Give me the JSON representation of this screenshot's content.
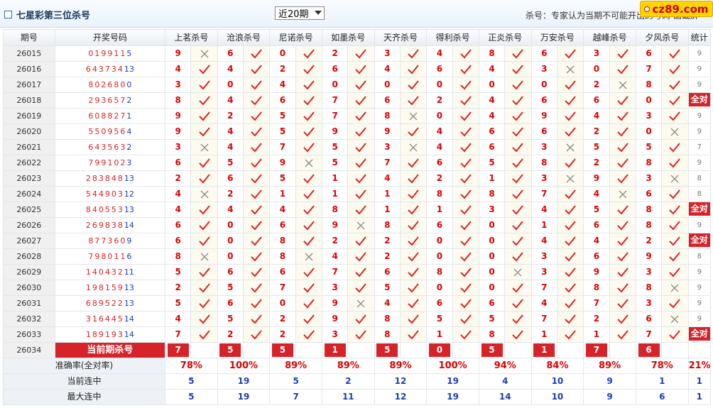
{
  "header": {
    "title": "七星彩第三位杀号",
    "select_value": "近20期",
    "note": "杀号：专家认为当期不可能开出的号码 画截屏",
    "logo": "cz89.com"
  },
  "columns": {
    "period": "期号",
    "draw": "开奖号码",
    "experts": [
      "上茗杀号",
      "沧浪杀号",
      "尼诺杀号",
      "如墨杀号",
      "天齐杀号",
      "得利杀号",
      "正炎杀号",
      "万安杀号",
      "越峰杀号",
      "夕风杀号"
    ],
    "stat": "统计"
  },
  "rows": [
    {
      "period": "26015",
      "draw_digits": "019911",
      "draw_last": "5",
      "cells": [
        [
          "9",
          "x"
        ],
        [
          "6",
          "v"
        ],
        [
          "0",
          "v"
        ],
        [
          "2",
          "v"
        ],
        [
          "3",
          "v"
        ],
        [
          "4",
          "v"
        ],
        [
          "8",
          "v"
        ],
        [
          "6",
          "v"
        ],
        [
          "3",
          "v"
        ],
        [
          "6",
          "v"
        ]
      ],
      "stat": "9"
    },
    {
      "period": "26016",
      "draw_digits": "643734",
      "draw_last": "13",
      "cells": [
        [
          "4",
          "v"
        ],
        [
          "4",
          "v"
        ],
        [
          "2",
          "v"
        ],
        [
          "6",
          "v"
        ],
        [
          "4",
          "v"
        ],
        [
          "6",
          "v"
        ],
        [
          "4",
          "v"
        ],
        [
          "3",
          "x"
        ],
        [
          "0",
          "v"
        ],
        [
          "7",
          "v"
        ]
      ],
      "stat": "9"
    },
    {
      "period": "26017",
      "draw_digits": "802680",
      "draw_last": "0",
      "cells": [
        [
          "3",
          "v"
        ],
        [
          "0",
          "v"
        ],
        [
          "4",
          "v"
        ],
        [
          "0",
          "v"
        ],
        [
          "0",
          "v"
        ],
        [
          "0",
          "v"
        ],
        [
          "0",
          "v"
        ],
        [
          "0",
          "v"
        ],
        [
          "2",
          "x"
        ],
        [
          "8",
          "v"
        ]
      ],
      "stat": "9"
    },
    {
      "period": "26018",
      "draw_digits": "293657",
      "draw_last": "2",
      "cells": [
        [
          "8",
          "v"
        ],
        [
          "4",
          "v"
        ],
        [
          "6",
          "v"
        ],
        [
          "7",
          "v"
        ],
        [
          "6",
          "v"
        ],
        [
          "2",
          "v"
        ],
        [
          "4",
          "v"
        ],
        [
          "6",
          "v"
        ],
        [
          "6",
          "v"
        ],
        [
          "0",
          "v"
        ]
      ],
      "stat": "全对"
    },
    {
      "period": "26019",
      "draw_digits": "608827",
      "draw_last": "1",
      "cells": [
        [
          "9",
          "v"
        ],
        [
          "2",
          "v"
        ],
        [
          "5",
          "v"
        ],
        [
          "7",
          "v"
        ],
        [
          "8",
          "x"
        ],
        [
          "0",
          "v"
        ],
        [
          "4",
          "v"
        ],
        [
          "9",
          "v"
        ],
        [
          "4",
          "v"
        ],
        [
          "3",
          "v"
        ]
      ],
      "stat": "9"
    },
    {
      "period": "26020",
      "draw_digits": "550956",
      "draw_last": "4",
      "cells": [
        [
          "9",
          "v"
        ],
        [
          "4",
          "v"
        ],
        [
          "5",
          "v"
        ],
        [
          "9",
          "v"
        ],
        [
          "9",
          "v"
        ],
        [
          "4",
          "v"
        ],
        [
          "6",
          "v"
        ],
        [
          "6",
          "v"
        ],
        [
          "2",
          "v"
        ],
        [
          "0",
          "x"
        ]
      ],
      "stat": "9"
    },
    {
      "period": "26021",
      "draw_digits": "643563",
      "draw_last": "2",
      "cells": [
        [
          "3",
          "x"
        ],
        [
          "4",
          "v"
        ],
        [
          "7",
          "v"
        ],
        [
          "5",
          "v"
        ],
        [
          "3",
          "x"
        ],
        [
          "4",
          "v"
        ],
        [
          "6",
          "v"
        ],
        [
          "3",
          "x"
        ],
        [
          "5",
          "v"
        ],
        [
          "5",
          "v"
        ]
      ],
      "stat": "7"
    },
    {
      "period": "26022",
      "draw_digits": "799102",
      "draw_last": "3",
      "cells": [
        [
          "6",
          "v"
        ],
        [
          "5",
          "v"
        ],
        [
          "9",
          "x"
        ],
        [
          "5",
          "v"
        ],
        [
          "7",
          "v"
        ],
        [
          "6",
          "v"
        ],
        [
          "5",
          "v"
        ],
        [
          "8",
          "v"
        ],
        [
          "2",
          "v"
        ],
        [
          "8",
          "v"
        ]
      ],
      "stat": "9"
    },
    {
      "period": "26023",
      "draw_digits": "283848",
      "draw_last": "13",
      "cells": [
        [
          "2",
          "v"
        ],
        [
          "6",
          "v"
        ],
        [
          "5",
          "v"
        ],
        [
          "1",
          "v"
        ],
        [
          "4",
          "v"
        ],
        [
          "2",
          "v"
        ],
        [
          "1",
          "v"
        ],
        [
          "3",
          "x"
        ],
        [
          "9",
          "v"
        ],
        [
          "3",
          "x"
        ]
      ],
      "stat": "8"
    },
    {
      "period": "26024",
      "draw_digits": "544903",
      "draw_last": "12",
      "cells": [
        [
          "4",
          "x"
        ],
        [
          "2",
          "v"
        ],
        [
          "1",
          "v"
        ],
        [
          "1",
          "v"
        ],
        [
          "1",
          "v"
        ],
        [
          "8",
          "v"
        ],
        [
          "8",
          "v"
        ],
        [
          "7",
          "v"
        ],
        [
          "4",
          "x"
        ],
        [
          "6",
          "v"
        ]
      ],
      "stat": "8"
    },
    {
      "period": "26025",
      "draw_digits": "840553",
      "draw_last": "13",
      "cells": [
        [
          "4",
          "v"
        ],
        [
          "4",
          "v"
        ],
        [
          "4",
          "v"
        ],
        [
          "8",
          "v"
        ],
        [
          "1",
          "v"
        ],
        [
          "1",
          "v"
        ],
        [
          "3",
          "v"
        ],
        [
          "4",
          "v"
        ],
        [
          "5",
          "v"
        ],
        [
          "8",
          "v"
        ]
      ],
      "stat": "全对"
    },
    {
      "period": "26026",
      "draw_digits": "269838",
      "draw_last": "14",
      "cells": [
        [
          "6",
          "v"
        ],
        [
          "0",
          "v"
        ],
        [
          "6",
          "v"
        ],
        [
          "9",
          "x"
        ],
        [
          "8",
          "v"
        ],
        [
          "6",
          "v"
        ],
        [
          "0",
          "v"
        ],
        [
          "1",
          "v"
        ],
        [
          "6",
          "v"
        ],
        [
          "8",
          "v"
        ]
      ],
      "stat": "9"
    },
    {
      "period": "26027",
      "draw_digits": "877360",
      "draw_last": "9",
      "cells": [
        [
          "6",
          "v"
        ],
        [
          "0",
          "v"
        ],
        [
          "8",
          "v"
        ],
        [
          "2",
          "v"
        ],
        [
          "2",
          "v"
        ],
        [
          "0",
          "v"
        ],
        [
          "0",
          "v"
        ],
        [
          "4",
          "v"
        ],
        [
          "4",
          "v"
        ],
        [
          "2",
          "v"
        ]
      ],
      "stat": "全对"
    },
    {
      "period": "26028",
      "draw_digits": "798011",
      "draw_last": "6",
      "cells": [
        [
          "8",
          "x"
        ],
        [
          "0",
          "v"
        ],
        [
          "8",
          "x"
        ],
        [
          "4",
          "v"
        ],
        [
          "2",
          "v"
        ],
        [
          "0",
          "v"
        ],
        [
          "0",
          "v"
        ],
        [
          "3",
          "v"
        ],
        [
          "6",
          "v"
        ],
        [
          "9",
          "v"
        ]
      ],
      "stat": "8"
    },
    {
      "period": "26029",
      "draw_digits": "140432",
      "draw_last": "11",
      "cells": [
        [
          "5",
          "v"
        ],
        [
          "6",
          "v"
        ],
        [
          "6",
          "v"
        ],
        [
          "7",
          "v"
        ],
        [
          "6",
          "v"
        ],
        [
          "8",
          "v"
        ],
        [
          "0",
          "x"
        ],
        [
          "3",
          "v"
        ],
        [
          "9",
          "v"
        ],
        [
          "3",
          "v"
        ]
      ],
      "stat": "9"
    },
    {
      "period": "26030",
      "draw_digits": "198159",
      "draw_last": "13",
      "cells": [
        [
          "2",
          "v"
        ],
        [
          "5",
          "v"
        ],
        [
          "7",
          "v"
        ],
        [
          "3",
          "v"
        ],
        [
          "5",
          "v"
        ],
        [
          "0",
          "v"
        ],
        [
          "0",
          "v"
        ],
        [
          "7",
          "v"
        ],
        [
          "8",
          "v"
        ],
        [
          "8",
          "x"
        ]
      ],
      "stat": "9"
    },
    {
      "period": "26031",
      "draw_digits": "689522",
      "draw_last": "13",
      "cells": [
        [
          "5",
          "v"
        ],
        [
          "6",
          "v"
        ],
        [
          "0",
          "v"
        ],
        [
          "9",
          "x"
        ],
        [
          "4",
          "v"
        ],
        [
          "6",
          "v"
        ],
        [
          "6",
          "v"
        ],
        [
          "4",
          "v"
        ],
        [
          "7",
          "v"
        ],
        [
          "3",
          "v"
        ]
      ],
      "stat": "9"
    },
    {
      "period": "26032",
      "draw_digits": "316445",
      "draw_last": "14",
      "cells": [
        [
          "4",
          "v"
        ],
        [
          "5",
          "v"
        ],
        [
          "2",
          "v"
        ],
        [
          "9",
          "v"
        ],
        [
          "8",
          "v"
        ],
        [
          "5",
          "v"
        ],
        [
          "5",
          "v"
        ],
        [
          "7",
          "v"
        ],
        [
          "2",
          "v"
        ],
        [
          "6",
          "x"
        ]
      ],
      "stat": "9"
    },
    {
      "period": "26033",
      "draw_digits": "189193",
      "draw_last": "14",
      "cells": [
        [
          "7",
          "v"
        ],
        [
          "2",
          "v"
        ],
        [
          "2",
          "v"
        ],
        [
          "3",
          "v"
        ],
        [
          "8",
          "v"
        ],
        [
          "1",
          "v"
        ],
        [
          "8",
          "v"
        ],
        [
          "1",
          "v"
        ],
        [
          "1",
          "v"
        ],
        [
          "7",
          "v"
        ]
      ],
      "stat": "全对"
    }
  ],
  "current": {
    "period": "26034",
    "label": "当前期杀号",
    "values": [
      "7",
      "5",
      "5",
      "1",
      "5",
      "0",
      "5",
      "1",
      "7",
      "6"
    ]
  },
  "summary": {
    "rate_label": "准确率(全对率)",
    "rates": [
      "78%",
      "100%",
      "89%",
      "89%",
      "89%",
      "100%",
      "94%",
      "84%",
      "89%",
      "78%"
    ],
    "rate_stat": "21%",
    "current_label": "当前连中",
    "current": [
      "5",
      "19",
      "5",
      "2",
      "12",
      "19",
      "4",
      "10",
      "9",
      "1"
    ],
    "current_stat": "1",
    "max_label": "最大连中",
    "max": [
      "5",
      "19",
      "7",
      "11",
      "12",
      "19",
      "14",
      "10",
      "9",
      "6"
    ],
    "max_stat": "1"
  },
  "colors": {
    "accent_red": "#d6232a",
    "number_red": "#dd0000",
    "blue": "#1a3eb8",
    "mark_bg": "#fdfbef"
  },
  "icons": {
    "hit": "check-icon",
    "miss": "cross-icon"
  }
}
